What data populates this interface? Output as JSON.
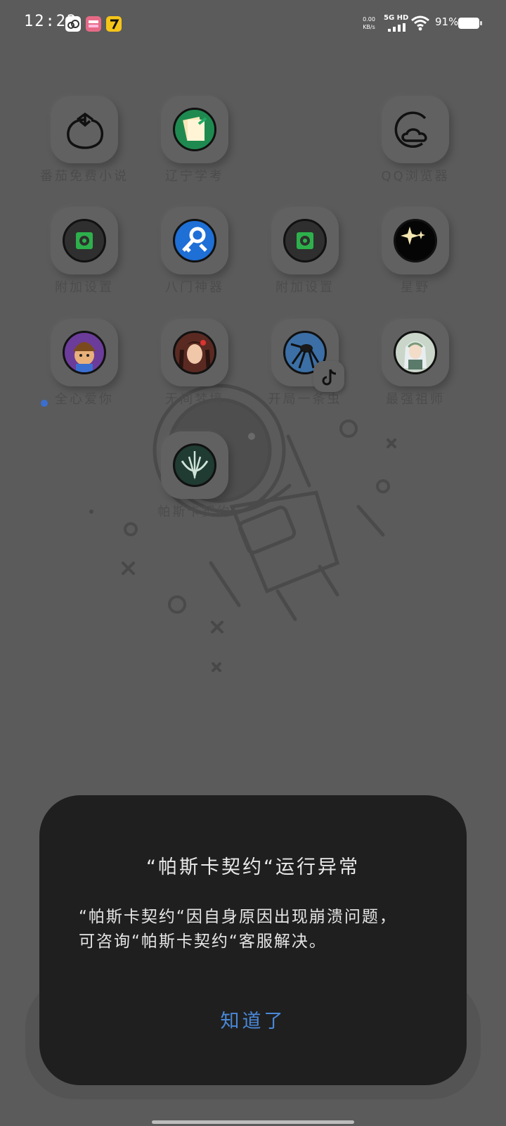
{
  "status_bar": {
    "time": "12:22",
    "net_speed_value": "0.00",
    "net_speed_unit": "KB/s",
    "network": "5G HD",
    "battery": "91%"
  },
  "apps": [
    {
      "label": "番茄免费小说",
      "icon": "tomato-icon"
    },
    {
      "label": "辽宁学考",
      "icon": "notebook-icon"
    },
    {
      "label": "QQ浏览器",
      "icon": "browser-icon"
    },
    {
      "label": "附加设置",
      "icon": "gear-icon"
    },
    {
      "label": "八门神器",
      "icon": "key-wrench-icon"
    },
    {
      "label": "附加设置",
      "icon": "gear-icon"
    },
    {
      "label": "星野",
      "icon": "sparkle-icon"
    },
    {
      "label": "全心爱你",
      "icon": "cartoon-face-icon"
    },
    {
      "label": "无间梦境",
      "icon": "portrait-icon"
    },
    {
      "label": "开局一条虫",
      "icon": "insect-icon"
    },
    {
      "label": "最强祖师",
      "icon": "anime-character-icon"
    },
    {
      "label": "帕斯卡契约",
      "icon": "emblem-icon"
    }
  ],
  "dialog": {
    "title": "“帕斯卡契约“运行异常",
    "message_line1": "“帕斯卡契约“因自身原因出现崩溃问题，",
    "message_line2": "可咨询“帕斯卡契约“客服解决。",
    "confirm_label": "知道了"
  }
}
